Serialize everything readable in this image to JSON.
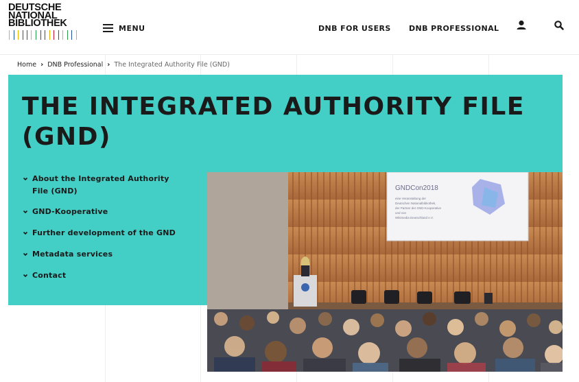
{
  "logo": {
    "line1": "DEUTSCHE",
    "line2": "NATIONAL",
    "line3": "BIBLIOTHEK"
  },
  "header": {
    "menu_label": "MENU",
    "nav": [
      "DNB FOR USERS",
      "DNB PROFESSIONAL"
    ],
    "icons": [
      "user-icon",
      "search-icon"
    ]
  },
  "breadcrumb": {
    "items": [
      "Home",
      "DNB Professional"
    ],
    "current": "The Integrated Authority File (GND)"
  },
  "page": {
    "title": "THE INTEGRATED AUTHORITY FILE (GND)"
  },
  "sub_nav": [
    "About the Integrated Authority File (GND)",
    "GND-Kooperative",
    "Further development of the GND",
    "Metadata services",
    "Contact"
  ],
  "photo": {
    "screen_title": "GNDCon2018",
    "screen_lines": [
      "eine Veranstaltung der",
      "Deutschen Nationalbibliothek,",
      "der Partner der GND-Kooperative",
      "und von",
      "Wikimedia Deutschland e.V."
    ]
  },
  "colors": {
    "accent": "#44cfc6",
    "text": "#1a1a1a"
  }
}
